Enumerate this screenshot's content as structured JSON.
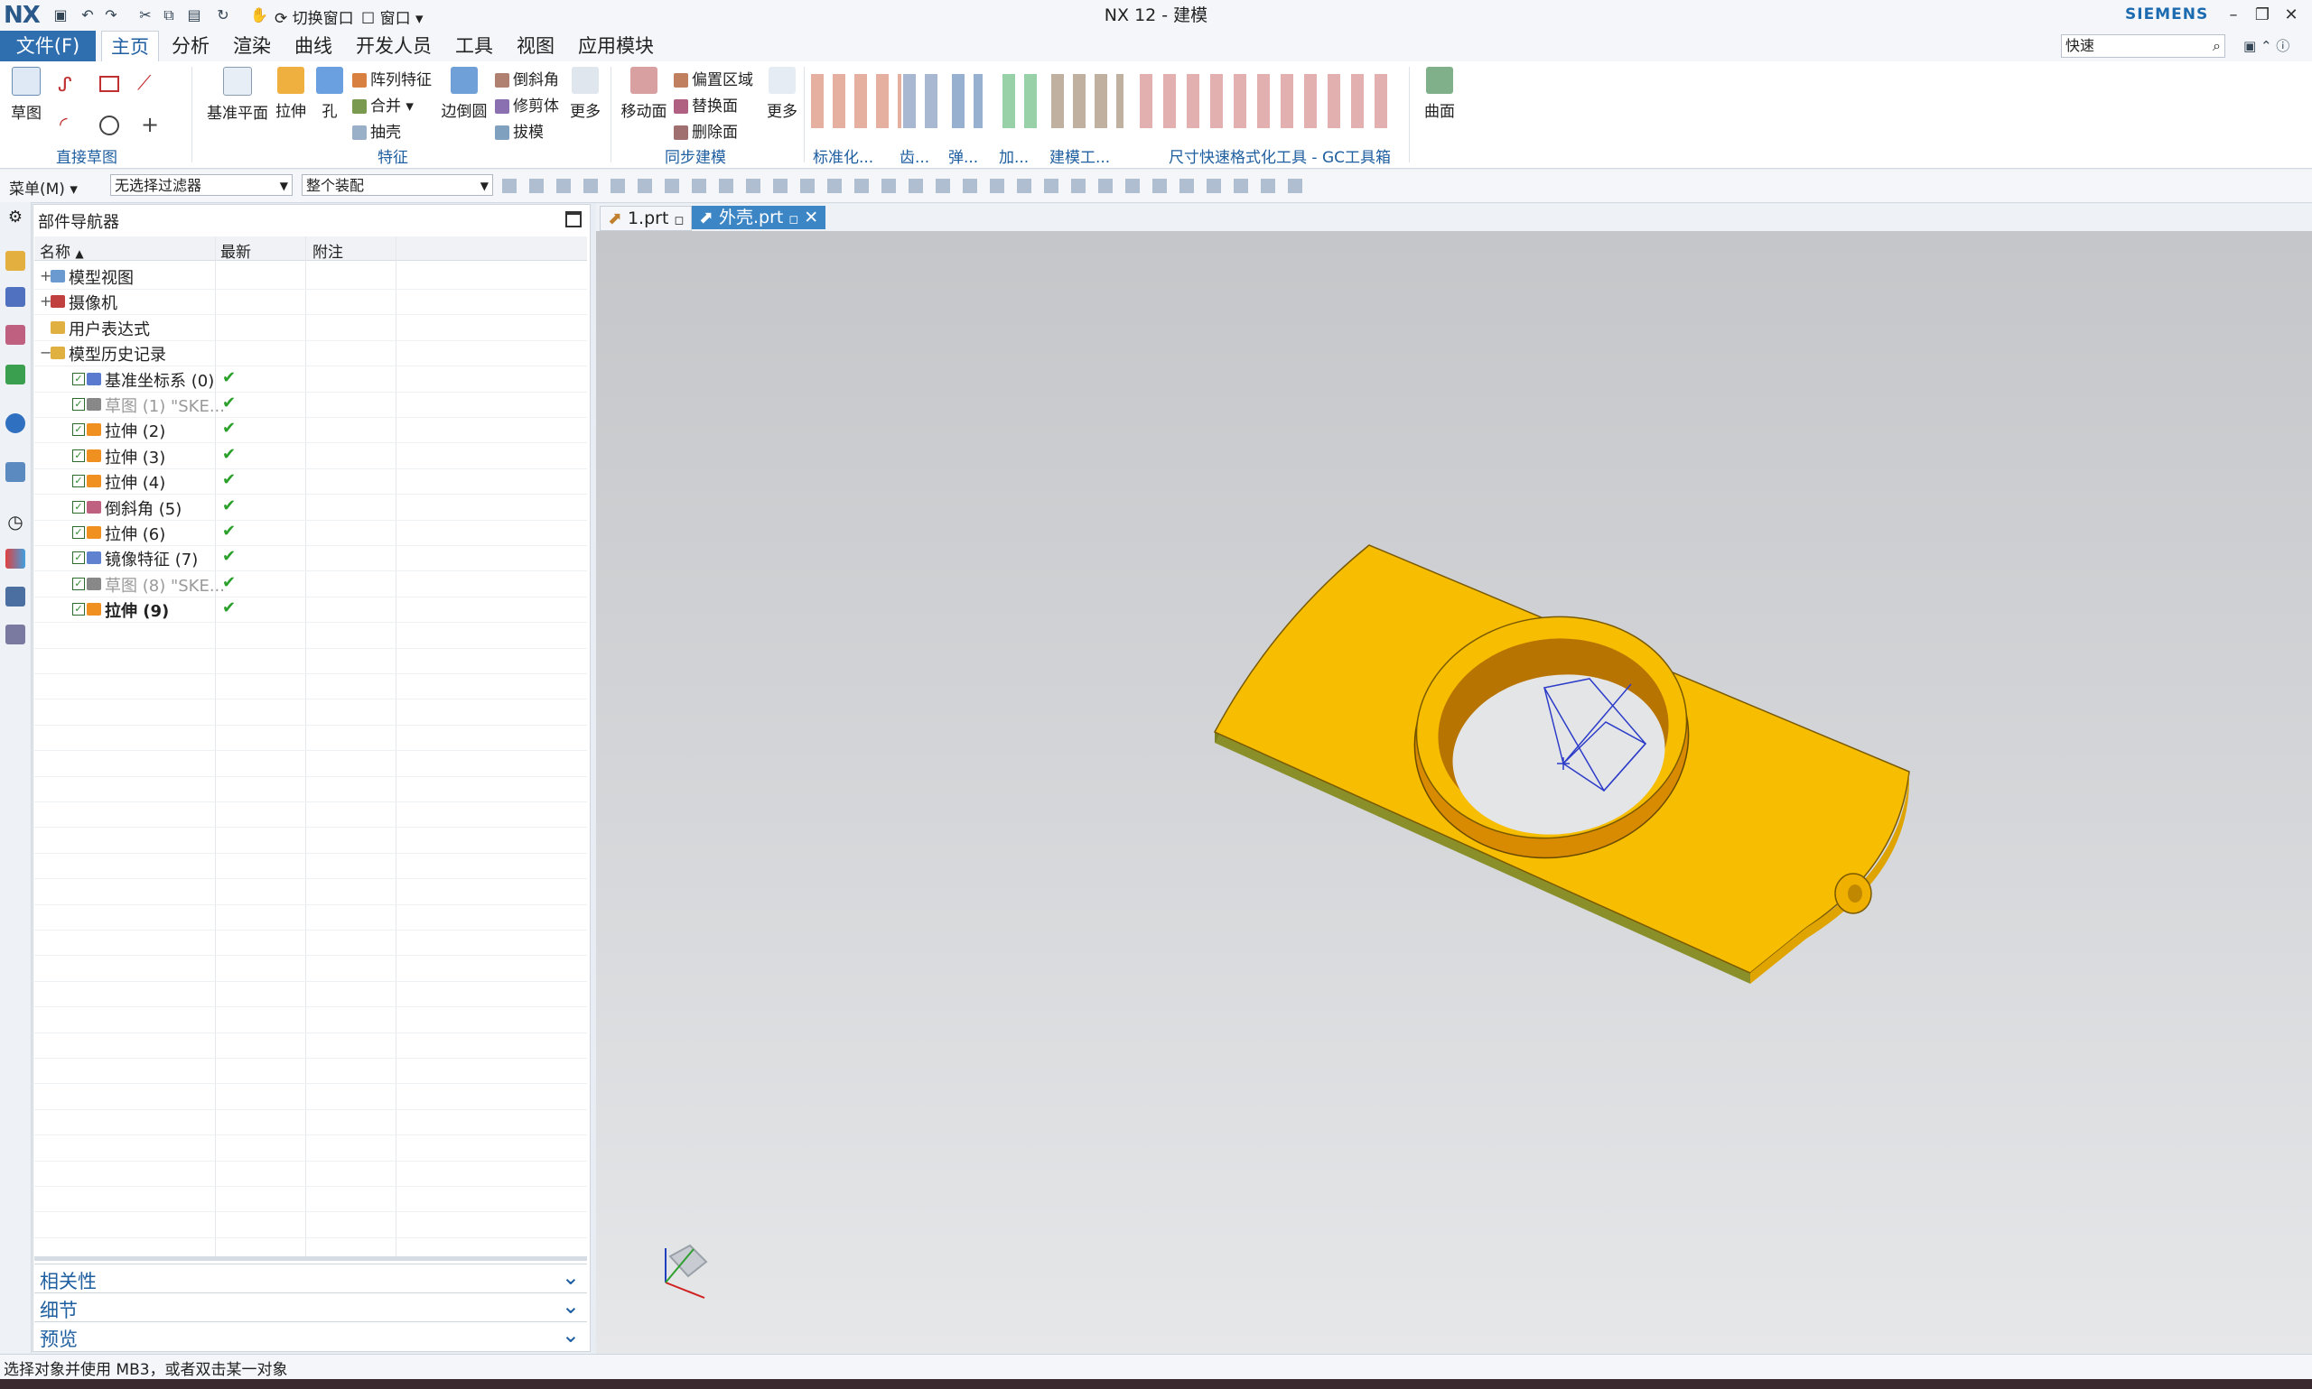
{
  "window": {
    "title": "NX 12 - 建模",
    "brand": "SIEMENS",
    "logo": "NX"
  },
  "quick_access": {
    "switch_window": "切换窗口",
    "window_menu": "窗口"
  },
  "menu_tabs": [
    "文件(F)",
    "主页",
    "分析",
    "渲染",
    "曲线",
    "开发人员",
    "工具",
    "视图",
    "应用模块"
  ],
  "active_tab": "主页",
  "search": {
    "value": "快速"
  },
  "ribbon": {
    "sketch": "草图",
    "direct_sketch_group": "直接草图",
    "datum_plane": "基准平面",
    "extrude": "拉伸",
    "hole": "孔",
    "pattern_feature": "阵列特征",
    "unite": "合并",
    "shell": "抽壳",
    "edge_blend": "边倒圆",
    "chamfer": "倒斜角",
    "trim_body": "修剪体",
    "draft": "拔模",
    "more1": "更多",
    "feature_group": "特征",
    "move_face": "移动面",
    "offset_region": "偏置区域",
    "replace_face": "替换面",
    "delete_face": "删除面",
    "more2": "更多",
    "sync_group": "同步建模",
    "standardize_group": "标准化...",
    "gear_group": "齿...",
    "spring_group": "弹...",
    "machining_group": "加...",
    "modeling_tools_group": "建模工...",
    "gc_toolbox_group": "尺寸快速格式化工具 - GC工具箱",
    "surface": "曲面"
  },
  "selection_bar": {
    "menu": "菜单(M)",
    "filter": "无选择过滤器",
    "scope": "整个装配"
  },
  "navigator": {
    "title": "部件导航器",
    "columns": [
      "名称",
      "最新",
      "附注"
    ],
    "rows": [
      {
        "expander": "+",
        "name": "模型视图",
        "latest": "",
        "style": ""
      },
      {
        "expander": "+",
        "name": "摄像机",
        "latest": "",
        "style": ""
      },
      {
        "expander": "",
        "name": "用户表达式",
        "latest": "",
        "style": ""
      },
      {
        "expander": "−",
        "name": "模型历史记录",
        "latest": "",
        "style": ""
      },
      {
        "expander": "",
        "name": "基准坐标系 (0)",
        "latest": "✔",
        "style": "child"
      },
      {
        "expander": "",
        "name": "草图 (1) \"SKE...",
        "latest": "✔",
        "style": "child dim"
      },
      {
        "expander": "",
        "name": "拉伸 (2)",
        "latest": "✔",
        "style": "child"
      },
      {
        "expander": "",
        "name": "拉伸 (3)",
        "latest": "✔",
        "style": "child"
      },
      {
        "expander": "",
        "name": "拉伸 (4)",
        "latest": "✔",
        "style": "child"
      },
      {
        "expander": "",
        "name": "倒斜角 (5)",
        "latest": "✔",
        "style": "child"
      },
      {
        "expander": "",
        "name": "拉伸 (6)",
        "latest": "✔",
        "style": "child"
      },
      {
        "expander": "",
        "name": "镜像特征 (7)",
        "latest": "✔",
        "style": "child"
      },
      {
        "expander": "",
        "name": "草图 (8) \"SKE...",
        "latest": "✔",
        "style": "child dim"
      },
      {
        "expander": "",
        "name": "拉伸 (9)",
        "latest": "✔",
        "style": "child bold"
      }
    ],
    "panels": [
      "相关性",
      "细节",
      "预览"
    ]
  },
  "file_tabs": [
    {
      "label": "1.prt",
      "active": false
    },
    {
      "label": "外壳.prt",
      "active": true
    }
  ],
  "status": {
    "text": "选择对象并使用 MB3，或者双击某一对象"
  },
  "colors": {
    "accent": "#2f6fb0",
    "model": "#f5b800",
    "model_dark": "#b07c00",
    "check": "#2aa02a"
  }
}
